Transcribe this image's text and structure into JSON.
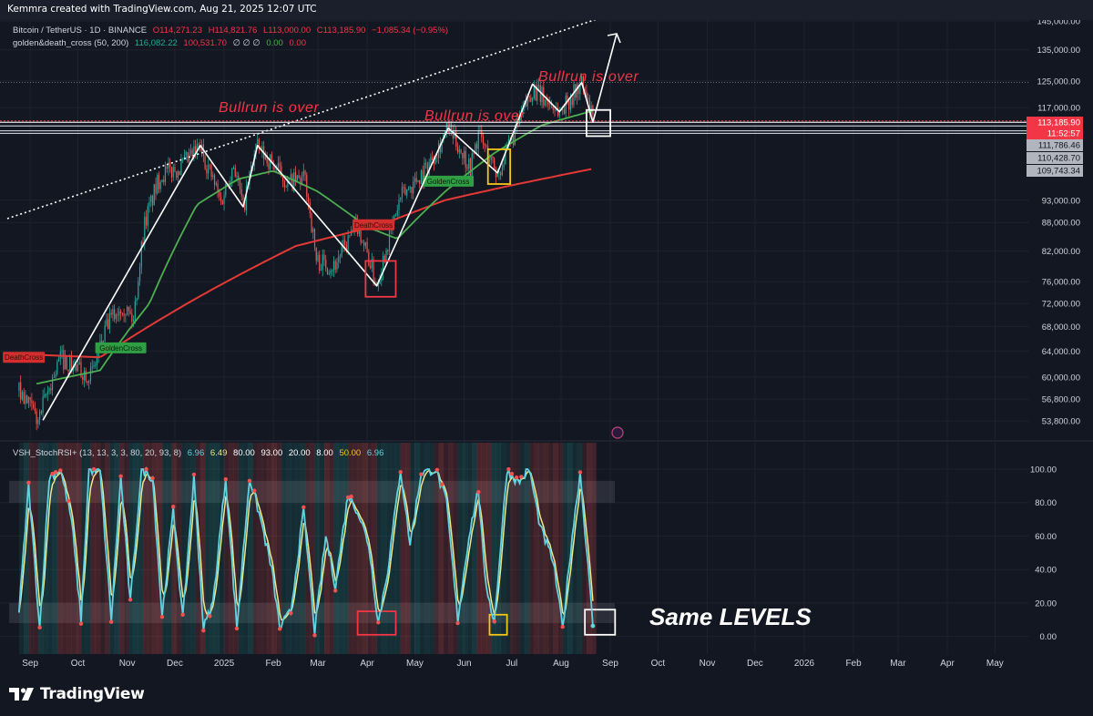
{
  "header": {
    "caption": "Kemmra created with TradingView.com, Aug 21, 2025 12:07 UTC"
  },
  "legend": {
    "symbol": "Bitcoin / TetherUS · 1D · BINANCE",
    "open": "O114,271.23",
    "high": "H114,821.76",
    "low": "L113,000.00",
    "close": "C113,185.90",
    "change": "−1,085.34 (−0.95%)",
    "indicator": "golden&death_cross (50, 200)",
    "ind_v1": "116,082.22",
    "ind_v2": "100,531.70",
    "ind_na": "∅ ∅ ∅",
    "ind_v3": "0.00",
    "ind_v4": "0.00",
    "osc_name": "VSH_StochRSI+ (13, 13, 3, 3, 80, 20, 93, 8)",
    "osc_v1": "6.96",
    "osc_v2": "6.49",
    "osc_v3": "80.00",
    "osc_v4": "93.00",
    "osc_v5": "20.00",
    "osc_v6": "8.00",
    "osc_v7": "50.00",
    "osc_v8": "6.96"
  },
  "colors": {
    "background": "#131722",
    "grid": "#1e222d",
    "up": "#26a69a",
    "down": "#ef5350",
    "ma50": "#4caf50",
    "ma200": "#e53935",
    "stoch_k": "#5fd3e0",
    "stoch_d": "#f0e68c",
    "annotation_red": "#f23645",
    "annotation_yellow": "#f5c518",
    "white": "#ffffff"
  },
  "chart_data": [
    {
      "type": "candlestick",
      "title": "Bitcoin / TetherUS · 1D · BINANCE",
      "x_ticks": [
        "Sep",
        "Oct",
        "Nov",
        "Dec",
        "2025",
        "Feb",
        "Mar",
        "Apr",
        "May",
        "Jun",
        "Jul",
        "Aug",
        "Sep",
        "Oct",
        "Nov",
        "Dec",
        "2026",
        "Feb",
        "Mar",
        "Apr",
        "May"
      ],
      "y_ticks": [
        "145,000.00",
        "135,000.00",
        "125,000.00",
        "117,000.00",
        "93,000.00",
        "88,000.00",
        "82,000.00",
        "76,000.00",
        "72,000.00",
        "68,000.00",
        "64,000.00",
        "60,000.00",
        "56,800.00",
        "53,800.00"
      ],
      "y_scale": "log",
      "ylim": [
        52500,
        146000
      ],
      "price_path": [
        [
          "2024-08-25",
          58000
        ],
        [
          "2024-09-06",
          53800
        ],
        [
          "2024-09-20",
          63000
        ],
        [
          "2024-10-01",
          61000
        ],
        [
          "2024-10-10",
          60500
        ],
        [
          "2024-10-20",
          68500
        ],
        [
          "2024-10-29",
          72000
        ],
        [
          "2024-11-05",
          69000
        ],
        [
          "2024-11-12",
          88000
        ],
        [
          "2024-11-22",
          99000
        ],
        [
          "2024-12-05",
          101000
        ],
        [
          "2024-12-17",
          106000
        ],
        [
          "2024-12-30",
          92500
        ],
        [
          "2025-01-07",
          102000
        ],
        [
          "2025-01-13",
          91000
        ],
        [
          "2025-01-21",
          106000
        ],
        [
          "2025-01-31",
          102000
        ],
        [
          "2025-02-10",
          97000
        ],
        [
          "2025-02-21",
          98000
        ],
        [
          "2025-02-28",
          80000
        ],
        [
          "2025-03-11",
          79000
        ],
        [
          "2025-03-26",
          87500
        ],
        [
          "2025-04-07",
          75500
        ],
        [
          "2025-04-22",
          93500
        ],
        [
          "2025-05-08",
          100500
        ],
        [
          "2025-05-22",
          111000
        ],
        [
          "2025-06-05",
          101000
        ],
        [
          "2025-06-10",
          109500
        ],
        [
          "2025-06-22",
          99000
        ],
        [
          "2025-07-03",
          110000
        ],
        [
          "2025-07-14",
          122500
        ],
        [
          "2025-07-31",
          115800
        ],
        [
          "2025-08-14",
          124000
        ],
        [
          "2025-08-21",
          113186
        ]
      ],
      "ma50_path": [
        [
          "2024-09-05",
          59000
        ],
        [
          "2024-10-15",
          61000
        ],
        [
          "2024-11-15",
          72000
        ],
        [
          "2024-12-15",
          92000
        ],
        [
          "2025-01-10",
          98000
        ],
        [
          "2025-02-01",
          100000
        ],
        [
          "2025-03-01",
          95000
        ],
        [
          "2025-04-01",
          87000
        ],
        [
          "2025-04-20",
          84500
        ],
        [
          "2025-05-20",
          95000
        ],
        [
          "2025-06-20",
          104500
        ],
        [
          "2025-07-20",
          112000
        ],
        [
          "2025-08-21",
          116082
        ]
      ],
      "ma200_path": [
        [
          "2024-08-25",
          63500
        ],
        [
          "2024-10-15",
          63000
        ],
        [
          "2024-12-15",
          73000
        ],
        [
          "2025-02-15",
          83000
        ],
        [
          "2025-04-10",
          87500
        ],
        [
          "2025-05-20",
          93000
        ],
        [
          "2025-07-01",
          96500
        ],
        [
          "2025-08-21",
          100532
        ]
      ],
      "price_labels": [
        {
          "value": "113,185.90",
          "color": "#f23645"
        },
        {
          "value": "11:52:57",
          "color": "#f23645"
        },
        {
          "value": "111,786.46",
          "color": "#d1d4dc"
        },
        {
          "value": "110,428.70",
          "color": "#d1d4dc"
        },
        {
          "value": "109,743.34",
          "color": "#d1d4dc"
        }
      ],
      "annotations": [
        "Bullrun is over",
        "Bullrun is over",
        "Bullrun is over"
      ],
      "cross_labels": [
        {
          "label": "GoldenCross",
          "date": "2024-10-28",
          "value": 64500
        },
        {
          "label": "GoldenCross",
          "date": "2025-05-22",
          "value": 97500
        },
        {
          "label": "DeathCross",
          "date": "2025-04-05",
          "value": 87500
        },
        {
          "label": "DeathCross",
          "date": "2024-08-28",
          "value": 63000
        }
      ]
    },
    {
      "type": "line",
      "title": "VSH_StochRSI+",
      "y_ticks": [
        "100.00",
        "80.00",
        "60.00",
        "40.00",
        "20.00",
        "0.00"
      ],
      "ylim": [
        -4,
        106
      ],
      "bands": [
        [
          80,
          93
        ],
        [
          8,
          20
        ]
      ],
      "series": [
        {
          "name": "K",
          "color": "#5fd3e0"
        },
        {
          "name": "D",
          "color": "#f0e68c"
        }
      ],
      "k_path": [
        [
          "2024-08-25",
          15
        ],
        [
          "2024-08-31",
          90
        ],
        [
          "2024-09-07",
          5
        ],
        [
          "2024-09-13",
          95
        ],
        [
          "2024-09-20",
          100
        ],
        [
          "2024-09-27",
          70
        ],
        [
          "2024-10-03",
          10
        ],
        [
          "2024-10-08",
          100
        ],
        [
          "2024-10-15",
          98
        ],
        [
          "2024-10-22",
          10
        ],
        [
          "2024-10-28",
          95
        ],
        [
          "2024-11-03",
          20
        ],
        [
          "2024-11-10",
          100
        ],
        [
          "2024-11-17",
          95
        ],
        [
          "2024-11-23",
          12
        ],
        [
          "2024-11-30",
          75
        ],
        [
          "2024-12-06",
          10
        ],
        [
          "2024-12-13",
          95
        ],
        [
          "2024-12-19",
          5
        ],
        [
          "2024-12-25",
          20
        ],
        [
          "2025-01-02",
          95
        ],
        [
          "2025-01-09",
          5
        ],
        [
          "2025-01-17",
          95
        ],
        [
          "2025-01-24",
          70
        ],
        [
          "2025-01-31",
          40
        ],
        [
          "2025-02-05",
          5
        ],
        [
          "2025-02-12",
          15
        ],
        [
          "2025-02-20",
          75
        ],
        [
          "2025-02-27",
          3
        ],
        [
          "2025-03-06",
          60
        ],
        [
          "2025-03-12",
          30
        ],
        [
          "2025-03-20",
          85
        ],
        [
          "2025-03-26",
          75
        ],
        [
          "2025-04-02",
          55
        ],
        [
          "2025-04-08",
          8
        ],
        [
          "2025-04-14",
          40
        ],
        [
          "2025-04-22",
          100
        ],
        [
          "2025-04-28",
          55
        ],
        [
          "2025-05-05",
          98
        ],
        [
          "2025-05-14",
          100
        ],
        [
          "2025-05-21",
          80
        ],
        [
          "2025-05-28",
          10
        ],
        [
          "2025-06-04",
          60
        ],
        [
          "2025-06-10",
          88
        ],
        [
          "2025-06-14",
          35
        ],
        [
          "2025-06-20",
          8
        ],
        [
          "2025-06-28",
          100
        ],
        [
          "2025-07-05",
          92
        ],
        [
          "2025-07-12",
          100
        ],
        [
          "2025-07-19",
          65
        ],
        [
          "2025-07-27",
          45
        ],
        [
          "2025-08-02",
          5
        ],
        [
          "2025-08-08",
          60
        ],
        [
          "2025-08-13",
          98
        ],
        [
          "2025-08-21",
          7
        ]
      ]
    }
  ],
  "price_panel_annotations": {
    "label": "Bullrun is over"
  },
  "oscillator_annotation": {
    "label": "Same LEVELS"
  },
  "footer": {
    "logo_text": "TradingView"
  }
}
